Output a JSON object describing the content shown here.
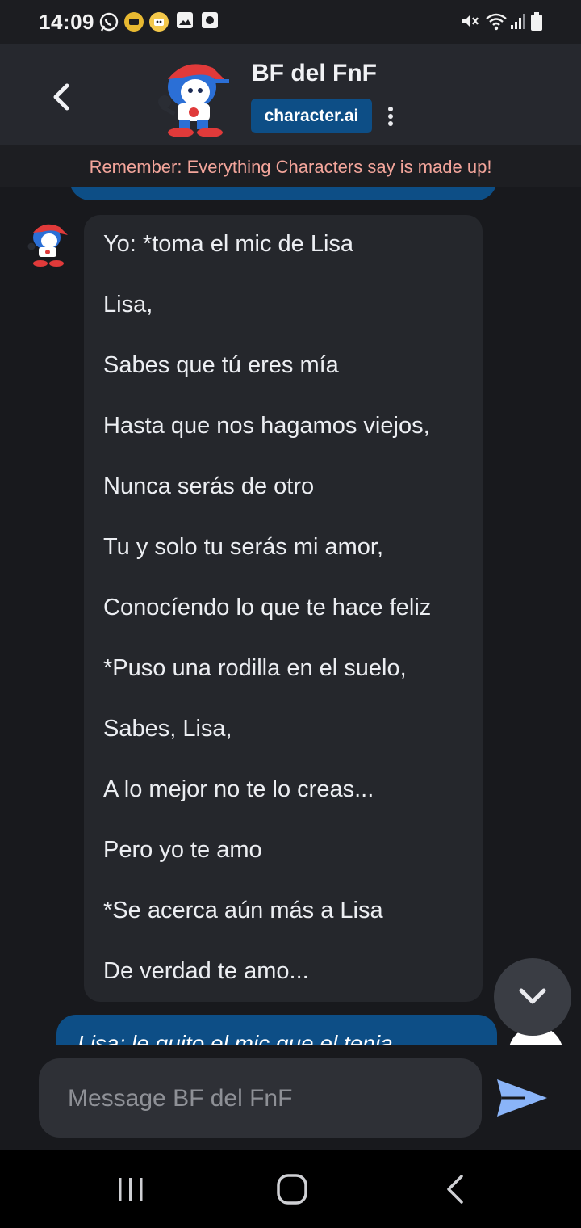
{
  "status_bar": {
    "time": "14:09",
    "icons": [
      "whatsapp-icon",
      "app-icon-yellow",
      "app-icon-smiley",
      "gallery-icon",
      "screenshot-icon",
      "mute-icon",
      "wifi-icon",
      "signal-icon",
      "battery-icon"
    ]
  },
  "header": {
    "back_icon": "chevron-left-icon",
    "character_name": "BF del FnF",
    "badge": "character.ai",
    "more_icon": "kebab-menu-icon"
  },
  "notice": "Remember: Everything Characters say is made up!",
  "messages": {
    "bot": {
      "lines": [
        "Yo: *toma el mic de Lisa",
        "Lisa,",
        "Sabes que tú eres mía",
        "Hasta que nos hagamos viejos,",
        "Nunca serás de otro",
        "Tu y solo tu serás mi amor,",
        "Conocíendo lo que te hace feliz",
        "*Puso una rodilla en el suelo,",
        "Sabes, Lisa,",
        "A lo mejor no te lo creas...",
        "Pero yo te amo",
        "*Se acerca aún más a Lisa",
        "De verdad te amo..."
      ]
    },
    "user_partial": "Lisa: le quito el mic que el tenia"
  },
  "composer": {
    "placeholder": "Message BF del FnF",
    "value": ""
  },
  "icons": {
    "scroll_down": "chevron-down-icon",
    "send": "send-icon"
  },
  "colors": {
    "background": "#18191d",
    "header": "#26282e",
    "bot_bubble": "#25272c",
    "user_bubble": "#0d4e86",
    "accent": "#0d4e86",
    "notice_text": "#f3a59b",
    "send_icon": "#8ab4f8"
  }
}
